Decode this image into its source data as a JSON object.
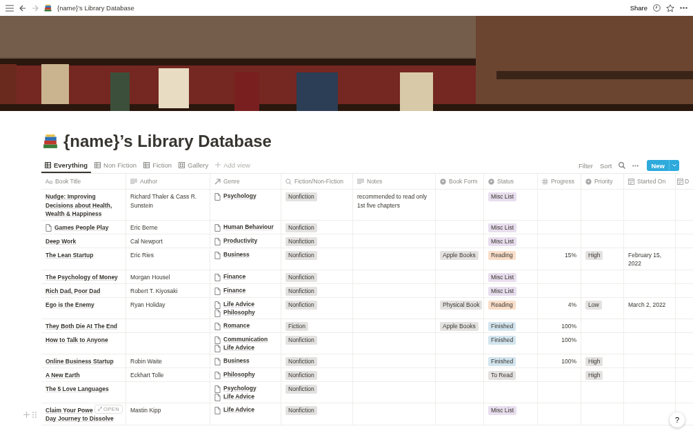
{
  "topbar": {
    "title": "{name}’s Library Database",
    "share": "Share"
  },
  "page": {
    "title": "{name}’s Library Database"
  },
  "views": [
    {
      "label": "Everything",
      "kind": "table",
      "selected": true
    },
    {
      "label": "Non Fiction",
      "kind": "table",
      "selected": false
    },
    {
      "label": "Fiction",
      "kind": "table",
      "selected": false
    },
    {
      "label": "Gallery",
      "kind": "gallery",
      "selected": false
    }
  ],
  "add_view": "Add view",
  "toolbar": {
    "filter": "Filter",
    "sort": "Sort",
    "new": "New"
  },
  "table": {
    "columns": [
      {
        "label": "Book Title",
        "kind": "title"
      },
      {
        "label": "Author",
        "kind": "text"
      },
      {
        "label": "Genre",
        "kind": "relation"
      },
      {
        "label": "Fiction/Non-Fiction",
        "kind": "lookup"
      },
      {
        "label": "Notes",
        "kind": "text"
      },
      {
        "label": "Book Form",
        "kind": "select"
      },
      {
        "label": "Status",
        "kind": "select"
      },
      {
        "label": "Progress",
        "kind": "number"
      },
      {
        "label": "Priority",
        "kind": "select"
      },
      {
        "label": "Started On",
        "kind": "date"
      },
      {
        "label": "D",
        "kind": "date"
      }
    ],
    "rows": [
      {
        "title": "Nudge: Improving Decisions about Health, Wealth & Happiness",
        "page_icon": false,
        "author": "Richard Thaler & Cass R. Sunstein",
        "genre": [
          "Psychology"
        ],
        "type": "Nonfiction",
        "notes": "recommended to read only 1st five chapters",
        "status": {
          "label": "Misc List",
          "color": "#e8deee"
        }
      },
      {
        "title": "Games People Play",
        "page_icon": true,
        "author": "Eric Berne",
        "genre": [
          "Human Behaviour"
        ],
        "type": "Nonfiction",
        "status": {
          "label": "Misc List",
          "color": "#e8deee"
        }
      },
      {
        "title": "Deep Work",
        "page_icon": false,
        "author": "Cal Newport",
        "genre": [
          "Productivity"
        ],
        "type": "Nonfiction",
        "status": {
          "label": "Misc List",
          "color": "#e8deee"
        }
      },
      {
        "title": "The Lean Startup",
        "page_icon": false,
        "author": "Eric Ries",
        "genre": [
          "Business"
        ],
        "type": "Nonfiction",
        "form": "Apple Books",
        "status": {
          "label": "Reading",
          "color": "#fadec9"
        },
        "progress": "15%",
        "priority": "High",
        "started": "February 15, 2022"
      },
      {
        "title": "The Psychology of Money",
        "page_icon": false,
        "author": "Morgan Housel",
        "genre": [
          "Finance"
        ],
        "type": "Nonfiction",
        "status": {
          "label": "Misc List",
          "color": "#e8deee"
        }
      },
      {
        "title": "Rich Dad, Poor Dad",
        "page_icon": false,
        "author": "Robert T. Kiyosaki",
        "genre": [
          "Finance"
        ],
        "type": "Nonfiction",
        "status": {
          "label": "Misc List",
          "color": "#e8deee"
        }
      },
      {
        "title": "Ego is the Enemy",
        "page_icon": false,
        "author": "Ryan Holiday",
        "genre": [
          "Life Advice",
          "Philosophy"
        ],
        "type": "Nonfiction",
        "form": "Physical Book",
        "status": {
          "label": "Reading",
          "color": "#fadec9"
        },
        "progress": "4%",
        "priority": "Low",
        "started": "March 2, 2022"
      },
      {
        "title": "They Both Die At The End",
        "page_icon": false,
        "genre": [
          "Romance"
        ],
        "type": "Fiction",
        "form": "Apple Books",
        "status": {
          "label": "Finished",
          "color": "#d3e5ef"
        },
        "progress": "100%"
      },
      {
        "title": "How to Talk to Anyone",
        "page_icon": false,
        "genre": [
          "Communication",
          "Life Advice"
        ],
        "type": "Nonfiction",
        "status": {
          "label": "Finished",
          "color": "#d3e5ef"
        },
        "progress": "100%"
      },
      {
        "title": "Online Business Startup",
        "page_icon": false,
        "author": "Robin Waite",
        "genre": [
          "Business"
        ],
        "type": "Nonfiction",
        "status": {
          "label": "Finished",
          "color": "#d3e5ef"
        },
        "progress": "100%",
        "priority": "High"
      },
      {
        "title": "A New Earth",
        "page_icon": false,
        "author": "Eckhart Tolle",
        "genre": [
          "Philosophy"
        ],
        "type": "Nonfiction",
        "status": {
          "label": "To Read",
          "color": "#e3e2e0"
        },
        "priority": "High"
      },
      {
        "title": "The 5 Love Languages",
        "page_icon": false,
        "genre": [
          "Psychology",
          "Life Advice"
        ],
        "type": "Nonfiction"
      },
      {
        "title": "Claim Your Powe",
        "title_continued": "Day Journey to Dissolve",
        "page_icon": false,
        "open_button": "OPEN",
        "author": "Mastin Kipp",
        "genre": [
          "Life Advice"
        ],
        "type": "Nonfiction",
        "status": {
          "label": "Misc List",
          "color": "#e8deee"
        }
      }
    ]
  },
  "help": "?"
}
